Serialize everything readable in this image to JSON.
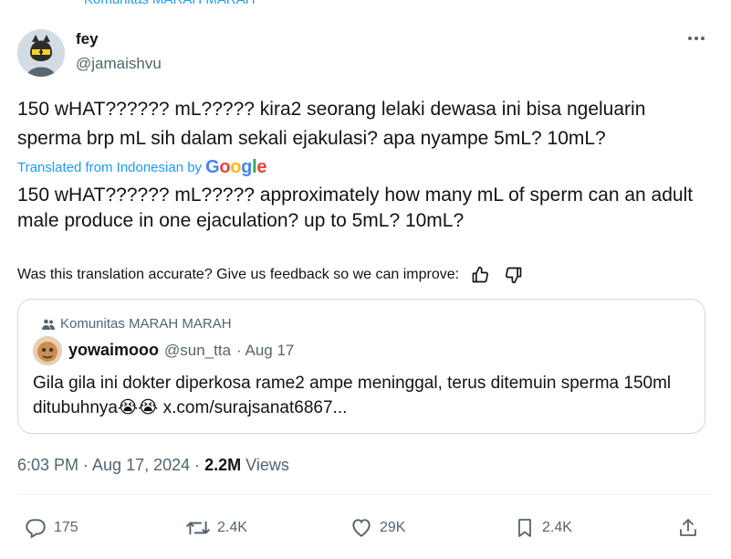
{
  "top_context": "Komunitas MARAH MARAH",
  "author": {
    "name": "fey",
    "handle": "@jamaishvu"
  },
  "tweet": {
    "text": "150 wHAT?????? mL????? kira2 seorang lelaki dewasa ini bisa ngeluarin sperma brp mL sih dalam sekali ejakulasi? apa nyampe 5mL? 10mL?",
    "translated_label": "Translated from Indonesian by",
    "translation": "150 wHAT?????? mL????? approximately how many mL of sperm can an adult male produce in one ejaculation? up to 5mL? 10mL?",
    "feedback_prompt": "Was this translation accurate? Give us feedback so we can improve:"
  },
  "google_logo": [
    "G",
    "o",
    "o",
    "g",
    "l",
    "e"
  ],
  "quote": {
    "community": "Komunitas MARAH MARAH",
    "name": "yowaimooo",
    "handle": "@sun_tta",
    "date": "· Aug 17",
    "text_before": "Gila gila ini dokter diperkosa rame2 ampe meninggal, terus ditemuin sperma 150ml ditubuhnya",
    "emojis": "😭😭",
    "link": "x.com/surajsanat6867..."
  },
  "meta": {
    "time": "6:03 PM · Aug 17, 2024 · ",
    "views_count": "2.2M",
    "views_label": " Views"
  },
  "actions": {
    "replies": "175",
    "reposts": "2.4K",
    "likes": "29K",
    "bookmarks": "2.4K"
  },
  "icons": {
    "more": "more-dots-icon",
    "thumbs_up": "thumbs-up-icon",
    "thumbs_down": "thumbs-down-icon",
    "community": "community-icon",
    "reply": "reply-icon",
    "repost": "repost-icon",
    "like": "heart-icon",
    "bookmark": "bookmark-icon",
    "share": "share-icon"
  },
  "colors": {
    "link": "#1d9bf0",
    "secondary": "#536471",
    "border": "#cfd9de"
  }
}
